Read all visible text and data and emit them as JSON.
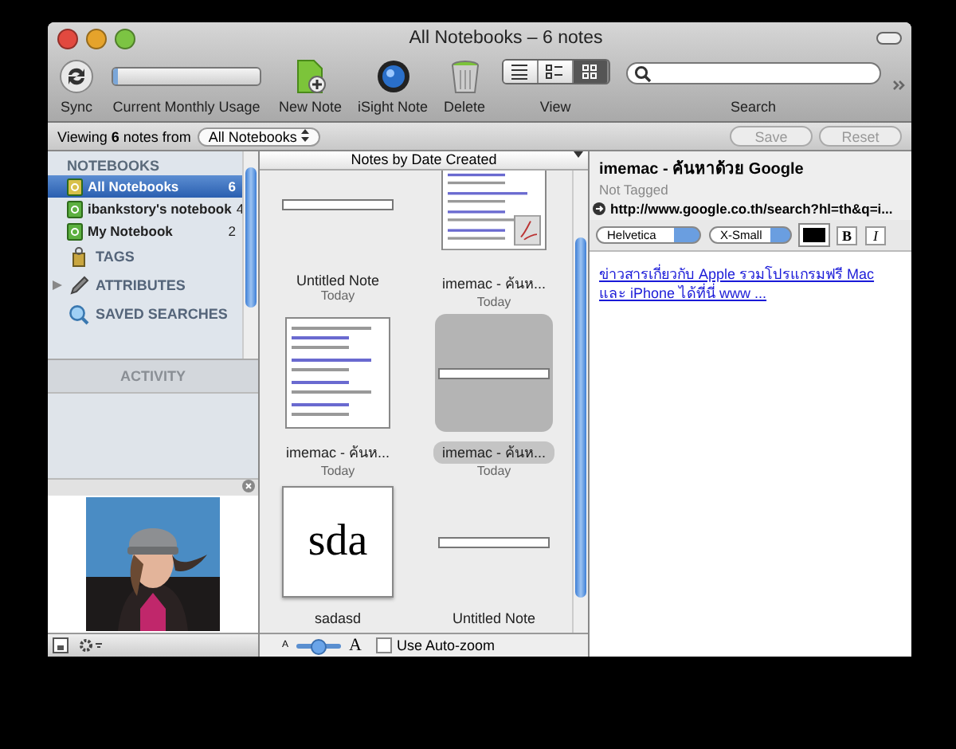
{
  "window": {
    "title": "All Notebooks – 6 notes"
  },
  "toolbar": {
    "items": [
      {
        "kind": "sync",
        "label": "Sync"
      },
      {
        "kind": "usage",
        "label": "Current Monthly Usage",
        "level": 0.03
      },
      {
        "kind": "new-note",
        "label": "New Note"
      },
      {
        "kind": "isight",
        "label": "iSight Note"
      },
      {
        "kind": "delete",
        "label": "Delete"
      },
      {
        "kind": "view",
        "label": "View",
        "options": [
          {
            "selected": false
          },
          {
            "selected": false
          },
          {
            "selected": true
          }
        ]
      },
      {
        "kind": "search",
        "label": "Search"
      }
    ]
  },
  "filter_bar": {
    "text": "Viewing **6** notes from",
    "notebook": "All Notebooks",
    "buttons": [
      {
        "label": "Save",
        "disabled": true
      },
      {
        "label": "Reset",
        "disabled": true
      }
    ]
  },
  "sidebar": {
    "notebooks_header": "NOTEBOOKS",
    "notebooks": [
      {
        "name": "All Notebooks",
        "count": "6",
        "selected": true
      },
      {
        "name": "ibankstory's notebook",
        "count": "4",
        "selected": false
      },
      {
        "name": "My Notebook",
        "count": "2",
        "selected": false
      }
    ],
    "sections": [
      {
        "kind": "tags",
        "label": "TAGS"
      },
      {
        "kind": "attributes",
        "label": "ATTRIBUTES",
        "expanded": false
      },
      {
        "kind": "searches",
        "label": "SAVED SEARCHES"
      }
    ],
    "activity": "ACTIVITY"
  },
  "notes": {
    "sort": "Notes by Date Created",
    "items": [
      {
        "kind": "blank",
        "title": "Untitled Note",
        "date": "Today",
        "selected": false
      },
      {
        "kind": "pdf",
        "title": "imemac - ค้นห...",
        "date": "Today",
        "selected": false
      },
      {
        "kind": "webpage",
        "title": "imemac - ค้นห...",
        "date": "Today",
        "selected": false
      },
      {
        "kind": "blank",
        "title": "imemac - ค้นห...",
        "date": "Today",
        "selected": true
      },
      {
        "kind": "text",
        "preview": "sda",
        "title": "sadasd",
        "selected": false
      },
      {
        "kind": "blank",
        "title": "Untitled Note",
        "selected": false
      }
    ],
    "zoom": {
      "small": "A",
      "large": "A",
      "level": 0.45,
      "auto_zoom_label": "Use Auto-zoom",
      "auto_zoom": false
    }
  },
  "editor": {
    "title": "imemac - ค้นหาด้วย Google",
    "tags": "Not Tagged",
    "url": "http://www.google.co.th/search?hl=th&q=i...",
    "font": "Helvetica",
    "size": "X-Small",
    "bold": "B",
    "italic": "I",
    "body_link": "ข่าวสารเกี่ยวกับ Apple รวมโปรแกรมฟรี Mac และ iPhone ได้ที่นี่ www ..."
  }
}
